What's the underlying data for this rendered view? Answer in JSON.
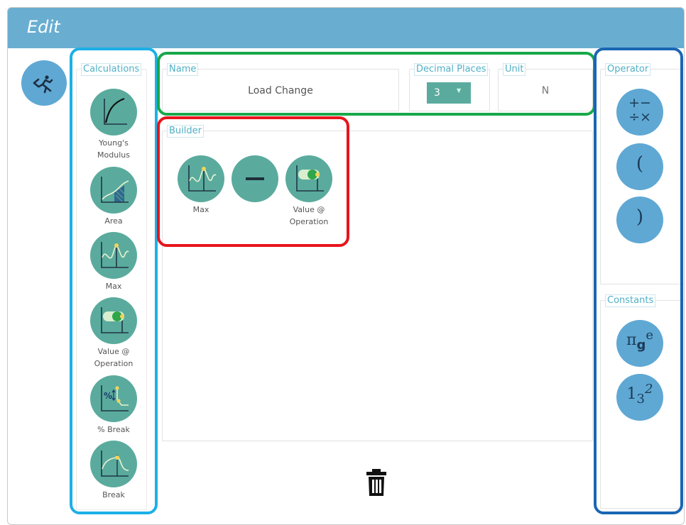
{
  "window": {
    "title": "Edit"
  },
  "calculations": {
    "legend": "Calculations",
    "items": [
      {
        "label_line1": "Young's",
        "label_line2": "Modulus",
        "icon": "youngs-modulus-icon"
      },
      {
        "label_line1": "Area",
        "label_line2": "",
        "icon": "area-icon"
      },
      {
        "label_line1": "Max",
        "label_line2": "",
        "icon": "max-icon"
      },
      {
        "label_line1": "Value @",
        "label_line2": "Operation",
        "icon": "value-at-operation-icon"
      },
      {
        "label_line1": "% Break",
        "label_line2": "",
        "icon": "percent-break-icon"
      },
      {
        "label_line1": "Break",
        "label_line2": "",
        "icon": "break-icon"
      }
    ]
  },
  "name_field": {
    "legend": "Name",
    "value": "Load Change"
  },
  "decimal_places": {
    "legend": "Decimal Places",
    "selected": "3"
  },
  "unit_field": {
    "legend": "Unit",
    "value": "N"
  },
  "builder": {
    "legend": "Builder",
    "tokens": [
      {
        "label_line1": "Max",
        "label_line2": ""
      },
      {
        "label_line1": "–",
        "label_line2": ""
      },
      {
        "label_line1": "Value @",
        "label_line2": "Operation"
      }
    ]
  },
  "operator": {
    "legend": "Operator",
    "buttons": [
      {
        "label": "+−\n÷×",
        "name": "arithmetic"
      },
      {
        "label": "(",
        "name": "open-paren"
      },
      {
        "label": ")",
        "name": "close-paren"
      }
    ]
  },
  "constants": {
    "legend": "Constants",
    "buttons": [
      {
        "name": "pi-g-e",
        "main": "π",
        "sub": "g",
        "sup": "e"
      },
      {
        "name": "numbers",
        "main": "1",
        "sub": "3",
        "sup": "2"
      }
    ]
  },
  "colors": {
    "titlebar": "#69aed1",
    "calc_circle": "#5aab9d",
    "op_circle": "#5fa8d4",
    "legend_text": "#4fb0c6",
    "highlight_calculations": "#1cb0e6",
    "highlight_name_row": "#17a84a",
    "highlight_builder": "#e8141b",
    "highlight_operator": "#1a66b3"
  }
}
